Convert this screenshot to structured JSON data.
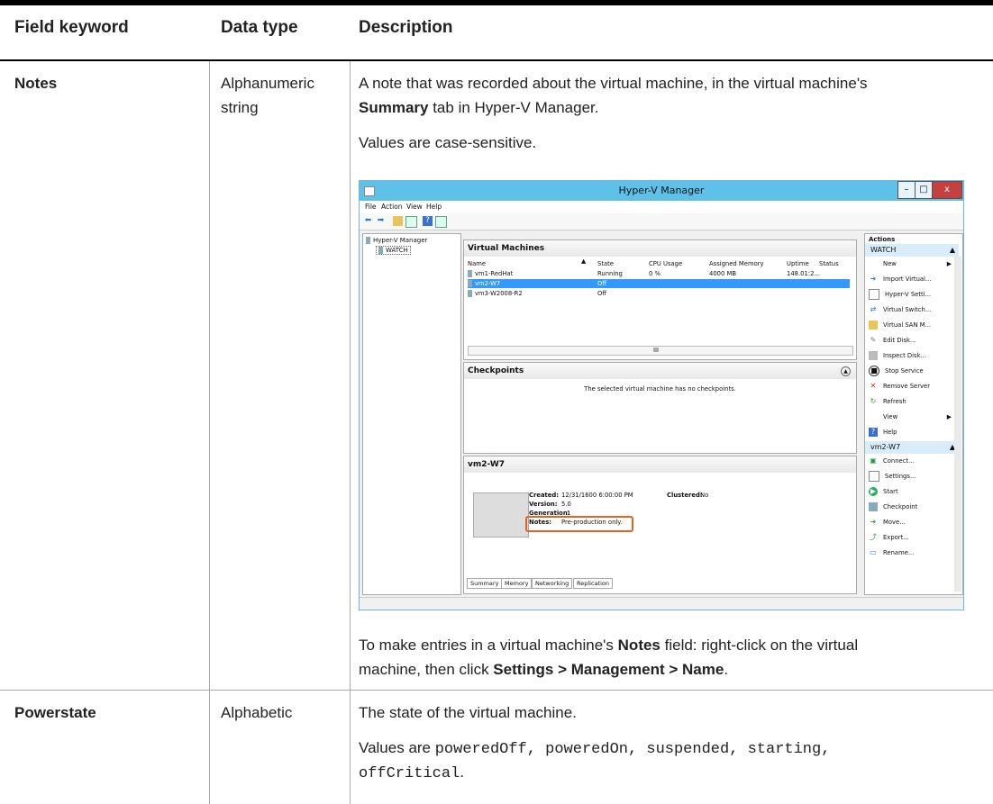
{
  "header": {
    "col1": "Field keyword",
    "col2": "Data type",
    "col3": "Description"
  },
  "rows": [
    {
      "keyword": "Notes",
      "type_line1": "Alphanumeric",
      "type_line2": "string",
      "desc_p1_a": "A note that was recorded about the virtual machine, in the virtual machine's",
      "desc_p1_bold": "Summary",
      "desc_p1_b": " tab in Hyper-V Manager.",
      "desc_p2": "Values are case-sensitive.",
      "desc_p3_a": "To make entries in a virtual machine's ",
      "desc_p3_bold1": "Notes",
      "desc_p3_b": " field: right-click on the virtual",
      "desc_p3_c": "machine, then click ",
      "desc_p3_bold2": "Settings > Management > Name",
      "desc_p3_d": "."
    },
    {
      "keyword": "Powerstate",
      "type_line1": "Alphabetic",
      "desc_p1": "The state of the virtual machine.",
      "desc_p2_a": "Values are ",
      "desc_p2_code_line1": "poweredOff, poweredOn, suspended, starting,",
      "desc_p2_code_line2": "offCritical",
      "desc_p2_end": "."
    }
  ],
  "screenshot": {
    "title": "Hyper-V Manager",
    "win_buttons": [
      "–",
      "□",
      "x"
    ],
    "menu": [
      "File",
      "Action",
      "View",
      "Help"
    ],
    "tree": {
      "root": "Hyper-V Manager",
      "child": "WATCH"
    },
    "vm_pane": {
      "title": "Virtual Machines",
      "columns": [
        "Name",
        "State",
        "CPU Usage",
        "Assigned Memory",
        "Uptime",
        "Status"
      ],
      "vms": [
        {
          "name": "vm1-RedHat",
          "state": "Running",
          "cpu": "0 %",
          "mem": "4000 MB",
          "uptime": "148.01:2..."
        },
        {
          "name": "vm2-W7",
          "state": "Off"
        },
        {
          "name": "vm3-W2008-R2",
          "state": "Off"
        }
      ],
      "scroll_mark": "III"
    },
    "checkpoints": {
      "title": "Checkpoints",
      "message": "The selected virtual machine has no checkpoints."
    },
    "detail": {
      "title": "vm2-W7",
      "created_label": "Created:",
      "created": "12/31/1600 6:00:00 PM",
      "clustered_label": "Clustered:",
      "clustered": "No",
      "version_label": "Version:",
      "version": "5.0",
      "generation_label": "Generation:",
      "generation": "1",
      "notes_label": "Notes:",
      "notes": "Pre-production only.",
      "tabs": [
        "Summary",
        "Memory",
        "Networking",
        "Replication"
      ]
    },
    "actions": {
      "title": "Actions",
      "group1": "WATCH",
      "items1": [
        "New",
        "Import Virtual...",
        "Hyper-V Setti...",
        "Virtual Switch...",
        "Virtual SAN M...",
        "Edit Disk...",
        "Inspect Disk...",
        "Stop Service",
        "Remove Server",
        "Refresh",
        "View",
        "Help"
      ],
      "group2": "vm2-W7",
      "items2": [
        "Connect...",
        "Settings...",
        "Start",
        "Checkpoint",
        "Move...",
        "Export...",
        "Rename..."
      ]
    },
    "highlight_color": "#e0641e",
    "selection_color": "#3399ff"
  }
}
